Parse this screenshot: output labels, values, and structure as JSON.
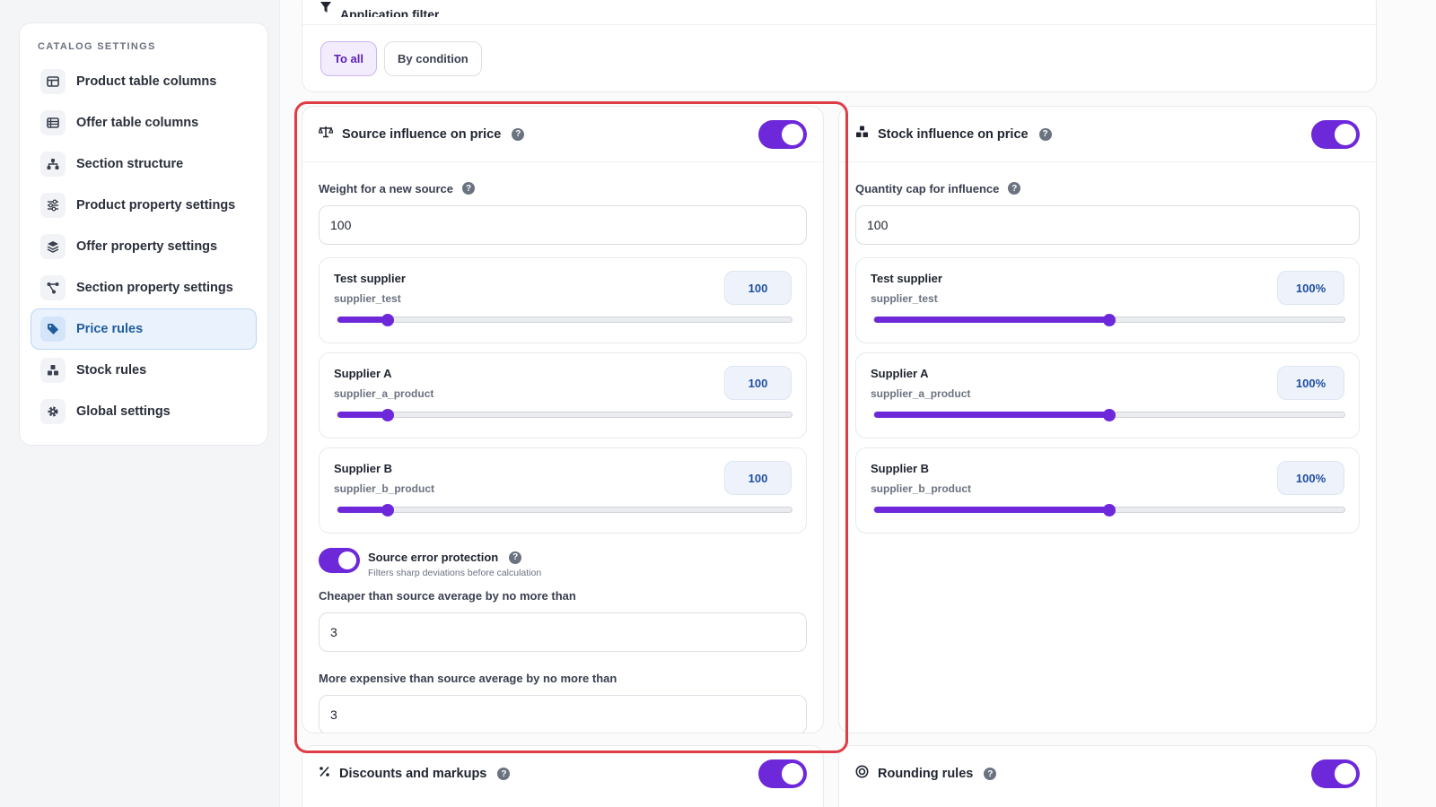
{
  "sidebar": {
    "title": "CATALOG SETTINGS",
    "items": [
      {
        "label": "Product table columns",
        "icon": "columns-icon"
      },
      {
        "label": "Offer table columns",
        "icon": "table-icon"
      },
      {
        "label": "Section structure",
        "icon": "hierarchy-icon"
      },
      {
        "label": "Product property settings",
        "icon": "sliders-icon"
      },
      {
        "label": "Offer property settings",
        "icon": "layers-icon"
      },
      {
        "label": "Section property settings",
        "icon": "nodes-icon"
      },
      {
        "label": "Price rules",
        "icon": "tag-icon",
        "active": true
      },
      {
        "label": "Stock rules",
        "icon": "boxes-icon"
      },
      {
        "label": "Global settings",
        "icon": "gear-icon"
      }
    ]
  },
  "app_filter": {
    "title": "Application filter",
    "options": [
      "To all",
      "By condition"
    ],
    "selected": "To all"
  },
  "source_card": {
    "title": "Source influence on price",
    "enabled": true,
    "weight_label": "Weight for a new source",
    "weight_value": "100",
    "suppliers": [
      {
        "name": "Test supplier",
        "code": "supplier_test",
        "value": "100",
        "level": 0.11
      },
      {
        "name": "Supplier A",
        "code": "supplier_a_product",
        "value": "100",
        "level": 0.11
      },
      {
        "name": "Supplier B",
        "code": "supplier_b_product",
        "value": "100",
        "level": 0.11
      }
    ],
    "protection_title": "Source error protection",
    "protection_sub": "Filters sharp deviations before calculation",
    "protection_enabled": true,
    "cheaper_label": "Cheaper than source average by no more than",
    "cheaper_value": "3",
    "expensive_label": "More expensive than source average by no more than",
    "expensive_value": "3"
  },
  "stock_card": {
    "title": "Stock influence on price",
    "enabled": true,
    "cap_label": "Quantity cap for influence",
    "cap_value": "100",
    "suppliers": [
      {
        "name": "Test supplier",
        "code": "supplier_test",
        "value": "100%",
        "level": 0.5
      },
      {
        "name": "Supplier A",
        "code": "supplier_a_product",
        "value": "100%",
        "level": 0.5
      },
      {
        "name": "Supplier B",
        "code": "supplier_b_product",
        "value": "100%",
        "level": 0.5
      }
    ]
  },
  "discounts_card": {
    "title": "Discounts and markups",
    "enabled": true
  },
  "rounding_card": {
    "title": "Rounding rules",
    "enabled": true
  },
  "colors": {
    "accent": "#6d28d9",
    "highlight": "#e03c46",
    "active_nav": "#1f5e9c"
  }
}
